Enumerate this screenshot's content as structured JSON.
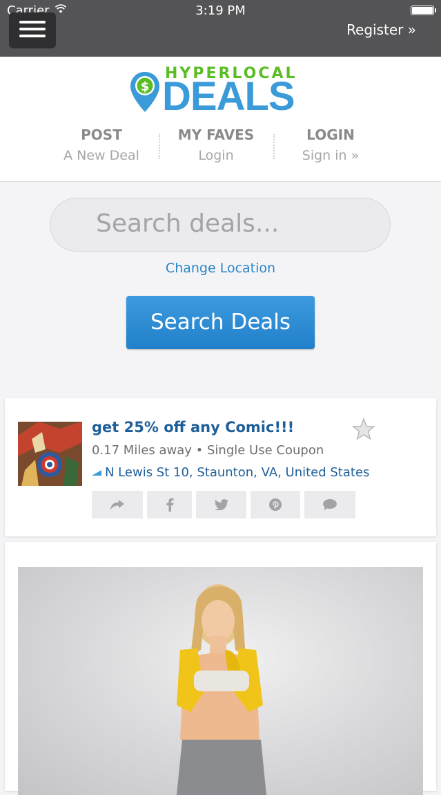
{
  "status_bar": {
    "carrier": "Carrier",
    "time": "3:19 PM"
  },
  "topbar": {
    "register": "Register »"
  },
  "logo": {
    "top": "HYPERLOCAL",
    "main": "DEALS",
    "pin_symbol": "$",
    "colors": {
      "green": "#5bbd24",
      "blue": "#3a9bd8"
    }
  },
  "nav": [
    {
      "title": "POST",
      "sub": "A New Deal"
    },
    {
      "title": "MY FAVES",
      "sub": "Login"
    },
    {
      "title": "LOGIN",
      "sub": "Sign in »"
    }
  ],
  "search": {
    "placeholder": "Search deals...",
    "change_location": "Change Location",
    "button": "Search Deals"
  },
  "deal": {
    "title": "get 25% off any Comic!!!",
    "meta": "0.17 Miles away • Single Use Coupon",
    "address": "N Lewis St 10, Staunton, VA, United States",
    "share_icons": [
      "share-icon",
      "facebook-icon",
      "twitter-icon",
      "pinterest-icon",
      "comment-icon"
    ]
  }
}
